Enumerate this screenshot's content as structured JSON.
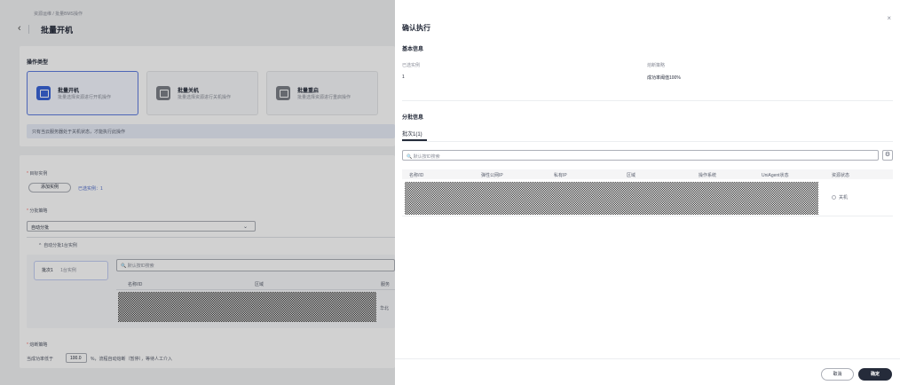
{
  "page": {
    "breadcrumb": "资源运维 / 批量BMS操作",
    "back_icon": "‹",
    "title": "批量开机"
  },
  "operation_type": {
    "section_title": "操作类型",
    "options": [
      {
        "title": "批量开机",
        "desc": "批量选择资源进行开机操作",
        "selected": true
      },
      {
        "title": "批量关机",
        "desc": "批量选择资源进行关机操作",
        "selected": false
      },
      {
        "title": "批量重启",
        "desc": "批量选择资源进行重启操作",
        "selected": false
      }
    ],
    "notice": "只有当云服务器处于关机状态，才能执行此操作"
  },
  "target": {
    "required_mark": "*",
    "label": "目标实例",
    "add_button": "添加实例",
    "selected_text": "已选实例：1",
    "strategy_label": "分批策略",
    "strategy_value": "自动分批",
    "group_label": "自动分批1台实例",
    "batch_tab": "批次1",
    "batch_count": "1台实例",
    "search_placeholder": "默认按ID搜索",
    "columns": [
      "名称/ID",
      "区域",
      "服务"
    ],
    "row_partial": "华北"
  },
  "fuse": {
    "label": "熔断策略",
    "prefix": "当成功率低于",
    "value": "100.0",
    "suffix": "%，流程自动熔断（暂停），等待人工介入"
  },
  "drawer": {
    "title": "确认执行",
    "close_icon": "×",
    "basic_title": "基本信息",
    "selected_label": "已选实例",
    "selected_value": "1",
    "fuse_label": "熔断策略",
    "fuse_value": "成功率阈值100%",
    "batch_title": "分批信息",
    "tab": "批次1(1)",
    "search_placeholder": "默认按ID搜索",
    "gear_icon": "⚙",
    "columns": [
      "名称/ID",
      "弹性公网IP",
      "私有IP",
      "区域",
      "操作系统",
      "UniAgent状态",
      "资源状态"
    ],
    "row_status": "关机",
    "cancel": "取消",
    "confirm": "确定"
  }
}
